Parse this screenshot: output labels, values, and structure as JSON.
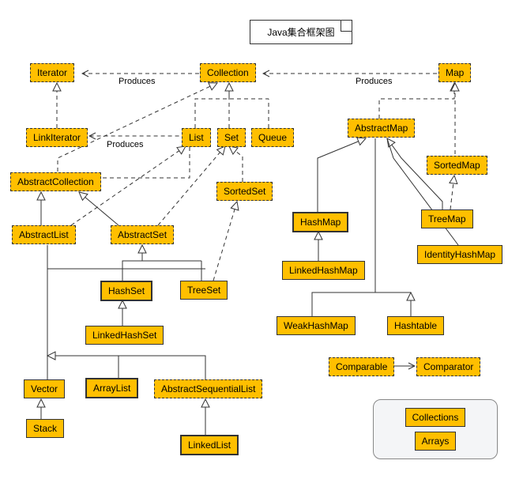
{
  "title": "Java集合框架图",
  "edge_labels": {
    "produces1": "Produces",
    "produces2": "Produces",
    "produces3": "Produces"
  },
  "nodes": {
    "iterator": "Iterator",
    "collection": "Collection",
    "map": "Map",
    "linkIterator": "LinkIterator",
    "list": "List",
    "set": "Set",
    "queue": "Queue",
    "abstractMap": "AbstractMap",
    "sortedMap": "SortedMap",
    "abstractCollection": "AbstractCollection",
    "sortedSet": "SortedSet",
    "hashMap": "HashMap",
    "treeMap": "TreeMap",
    "identityHashMap": "IdentityHashMap",
    "abstractList": "AbstractList",
    "abstractSet": "AbstractSet",
    "linkedHashMap": "LinkedHashMap",
    "hashSet": "HashSet",
    "treeSet": "TreeSet",
    "weakHashMap": "WeakHashMap",
    "hashtable": "Hashtable",
    "linkedHashSet": "LinkedHashSet",
    "comparable": "Comparable",
    "comparator": "Comparator",
    "vector": "Vector",
    "arrayList": "ArrayList",
    "abstractSequentialList": "AbstractSequentialList",
    "stack": "Stack",
    "linkedList": "LinkedList"
  },
  "legend": {
    "collections": "Collections",
    "arrays": "Arrays"
  },
  "chart_data": {
    "type": "uml-class-diagram",
    "title": "Java集合框架图",
    "nodes": [
      {
        "id": "Iterator",
        "stereotype": "interface"
      },
      {
        "id": "Collection",
        "stereotype": "interface"
      },
      {
        "id": "Map",
        "stereotype": "interface"
      },
      {
        "id": "LinkIterator",
        "stereotype": "interface"
      },
      {
        "id": "List",
        "stereotype": "interface"
      },
      {
        "id": "Set",
        "stereotype": "interface"
      },
      {
        "id": "Queue",
        "stereotype": "interface"
      },
      {
        "id": "AbstractMap",
        "stereotype": "abstract"
      },
      {
        "id": "SortedMap",
        "stereotype": "interface"
      },
      {
        "id": "AbstractCollection",
        "stereotype": "abstract"
      },
      {
        "id": "SortedSet",
        "stereotype": "interface"
      },
      {
        "id": "HashMap",
        "stereotype": "class",
        "emphasis": true
      },
      {
        "id": "TreeMap",
        "stereotype": "class"
      },
      {
        "id": "IdentityHashMap",
        "stereotype": "class"
      },
      {
        "id": "AbstractList",
        "stereotype": "abstract"
      },
      {
        "id": "AbstractSet",
        "stereotype": "abstract"
      },
      {
        "id": "LinkedHashMap",
        "stereotype": "class"
      },
      {
        "id": "HashSet",
        "stereotype": "class",
        "emphasis": true
      },
      {
        "id": "TreeSet",
        "stereotype": "class"
      },
      {
        "id": "WeakHashMap",
        "stereotype": "class"
      },
      {
        "id": "Hashtable",
        "stereotype": "class"
      },
      {
        "id": "LinkedHashSet",
        "stereotype": "class"
      },
      {
        "id": "Comparable",
        "stereotype": "interface"
      },
      {
        "id": "Comparator",
        "stereotype": "interface"
      },
      {
        "id": "Vector",
        "stereotype": "class"
      },
      {
        "id": "ArrayList",
        "stereotype": "class",
        "emphasis": true
      },
      {
        "id": "AbstractSequentialList",
        "stereotype": "abstract"
      },
      {
        "id": "Stack",
        "stereotype": "class"
      },
      {
        "id": "LinkedList",
        "stereotype": "class",
        "emphasis": true
      },
      {
        "id": "Collections",
        "stereotype": "utility"
      },
      {
        "id": "Arrays",
        "stereotype": "utility"
      }
    ],
    "edges": [
      {
        "from": "Collection",
        "to": "Iterator",
        "type": "dependency",
        "label": "Produces"
      },
      {
        "from": "Map",
        "to": "Collection",
        "type": "dependency",
        "label": "Produces"
      },
      {
        "from": "AbstractCollection",
        "to": "LinkIterator",
        "type": "dependency",
        "label": "Produces"
      },
      {
        "from": "LinkIterator",
        "to": "Iterator",
        "type": "realization"
      },
      {
        "from": "List",
        "to": "Collection",
        "type": "realization"
      },
      {
        "from": "Set",
        "to": "Collection",
        "type": "realization"
      },
      {
        "from": "Queue",
        "to": "Collection",
        "type": "realization"
      },
      {
        "from": "AbstractMap",
        "to": "Map",
        "type": "realization"
      },
      {
        "from": "SortedMap",
        "to": "Map",
        "type": "realization"
      },
      {
        "from": "AbstractCollection",
        "to": "Collection",
        "type": "realization"
      },
      {
        "from": "SortedSet",
        "to": "Set",
        "type": "realization"
      },
      {
        "from": "AbstractList",
        "to": "AbstractCollection",
        "type": "generalization"
      },
      {
        "from": "AbstractList",
        "to": "List",
        "type": "realization"
      },
      {
        "from": "AbstractSet",
        "to": "AbstractCollection",
        "type": "generalization"
      },
      {
        "from": "AbstractSet",
        "to": "Set",
        "type": "realization"
      },
      {
        "from": "HashMap",
        "to": "AbstractMap",
        "type": "generalization"
      },
      {
        "from": "LinkedHashMap",
        "to": "HashMap",
        "type": "generalization"
      },
      {
        "from": "TreeMap",
        "to": "AbstractMap",
        "type": "generalization"
      },
      {
        "from": "TreeMap",
        "to": "SortedMap",
        "type": "realization"
      },
      {
        "from": "IdentityHashMap",
        "to": "AbstractMap",
        "type": "generalization"
      },
      {
        "from": "WeakHashMap",
        "to": "AbstractMap",
        "type": "generalization"
      },
      {
        "from": "Hashtable",
        "to": "AbstractMap",
        "type": "generalization"
      },
      {
        "from": "HashSet",
        "to": "AbstractSet",
        "type": "generalization"
      },
      {
        "from": "TreeSet",
        "to": "AbstractSet",
        "type": "generalization"
      },
      {
        "from": "TreeSet",
        "to": "SortedSet",
        "type": "realization"
      },
      {
        "from": "LinkedHashSet",
        "to": "HashSet",
        "type": "generalization"
      },
      {
        "from": "Vector",
        "to": "AbstractList",
        "type": "generalization"
      },
      {
        "from": "ArrayList",
        "to": "AbstractList",
        "type": "generalization"
      },
      {
        "from": "AbstractSequentialList",
        "to": "AbstractList",
        "type": "generalization"
      },
      {
        "from": "Stack",
        "to": "Vector",
        "type": "generalization"
      },
      {
        "from": "LinkedList",
        "to": "AbstractSequentialList",
        "type": "generalization"
      },
      {
        "from": "Comparable",
        "to": "Comparator",
        "type": "association",
        "bidirectional": true
      }
    ]
  }
}
